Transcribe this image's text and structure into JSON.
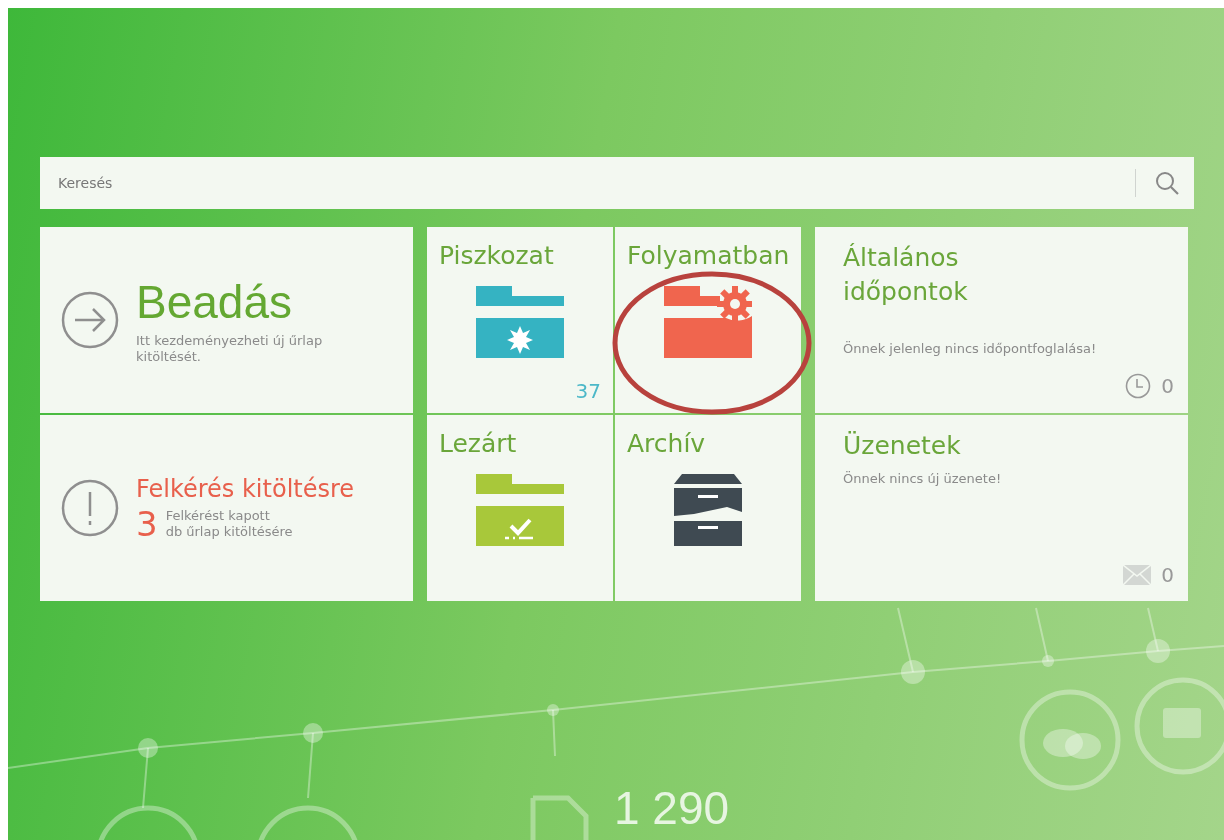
{
  "search": {
    "placeholder": "Keresés"
  },
  "submit_tile": {
    "title": "Beadás",
    "description": "Itt kezdeményezheti új űrlap kitöltését."
  },
  "request_tile": {
    "title": "Felkérés kitöltésre",
    "count": "3",
    "description_lines": [
      "Felkérést kapott",
      "db űrlap kitöltésére"
    ]
  },
  "folders": [
    {
      "label": "Piszkozat",
      "kind": "draft",
      "count": "37",
      "highlighted": false
    },
    {
      "label": "Folyamatban",
      "kind": "in_progress",
      "highlighted": true
    },
    {
      "label": "Lezárt",
      "kind": "closed",
      "highlighted": false
    },
    {
      "label": "Archív",
      "kind": "archive",
      "highlighted": false
    }
  ],
  "appointments": {
    "title": "Általános időpontok",
    "message": "Önnek jelenleg nincs időpontfoglalása!",
    "count": "0"
  },
  "messages": {
    "title": "Üzenetek",
    "message": "Önnek nincs új üzenete!",
    "count": "0"
  },
  "background_counter": "1 290"
}
